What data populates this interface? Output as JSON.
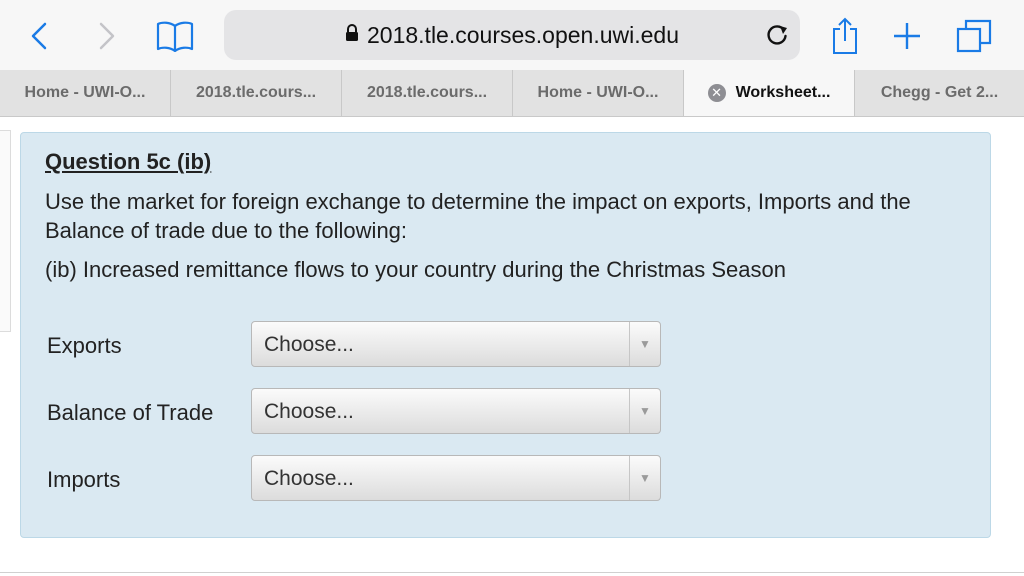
{
  "browser": {
    "url": "2018.tle.courses.open.uwi.edu",
    "accent_color": "#1a7be6",
    "icons": [
      "back-icon",
      "forward-icon",
      "bookmarks-icon",
      "lock-icon",
      "reload-icon",
      "share-icon",
      "new-tab-icon",
      "tabs-icon"
    ]
  },
  "tabs": [
    {
      "label": "Home - UWI-O..."
    },
    {
      "label": "2018.tle.cours..."
    },
    {
      "label": "2018.tle.cours..."
    },
    {
      "label": "Home - UWI-O..."
    },
    {
      "label": "Worksheet...",
      "active": true
    },
    {
      "label": "Chegg - Get 2..."
    }
  ],
  "question": {
    "title": "Question 5c (ib)",
    "body": "Use the market for foreign exchange to determine the impact on exports, Imports and the Balance of trade due to the following:",
    "sub": "(ib) Increased remittance flows to your country during the Christmas Season",
    "rows": [
      {
        "label": "Exports",
        "selected": "Choose..."
      },
      {
        "label": "Balance of Trade",
        "selected": "Choose..."
      },
      {
        "label": "Imports",
        "selected": "Choose..."
      }
    ]
  }
}
